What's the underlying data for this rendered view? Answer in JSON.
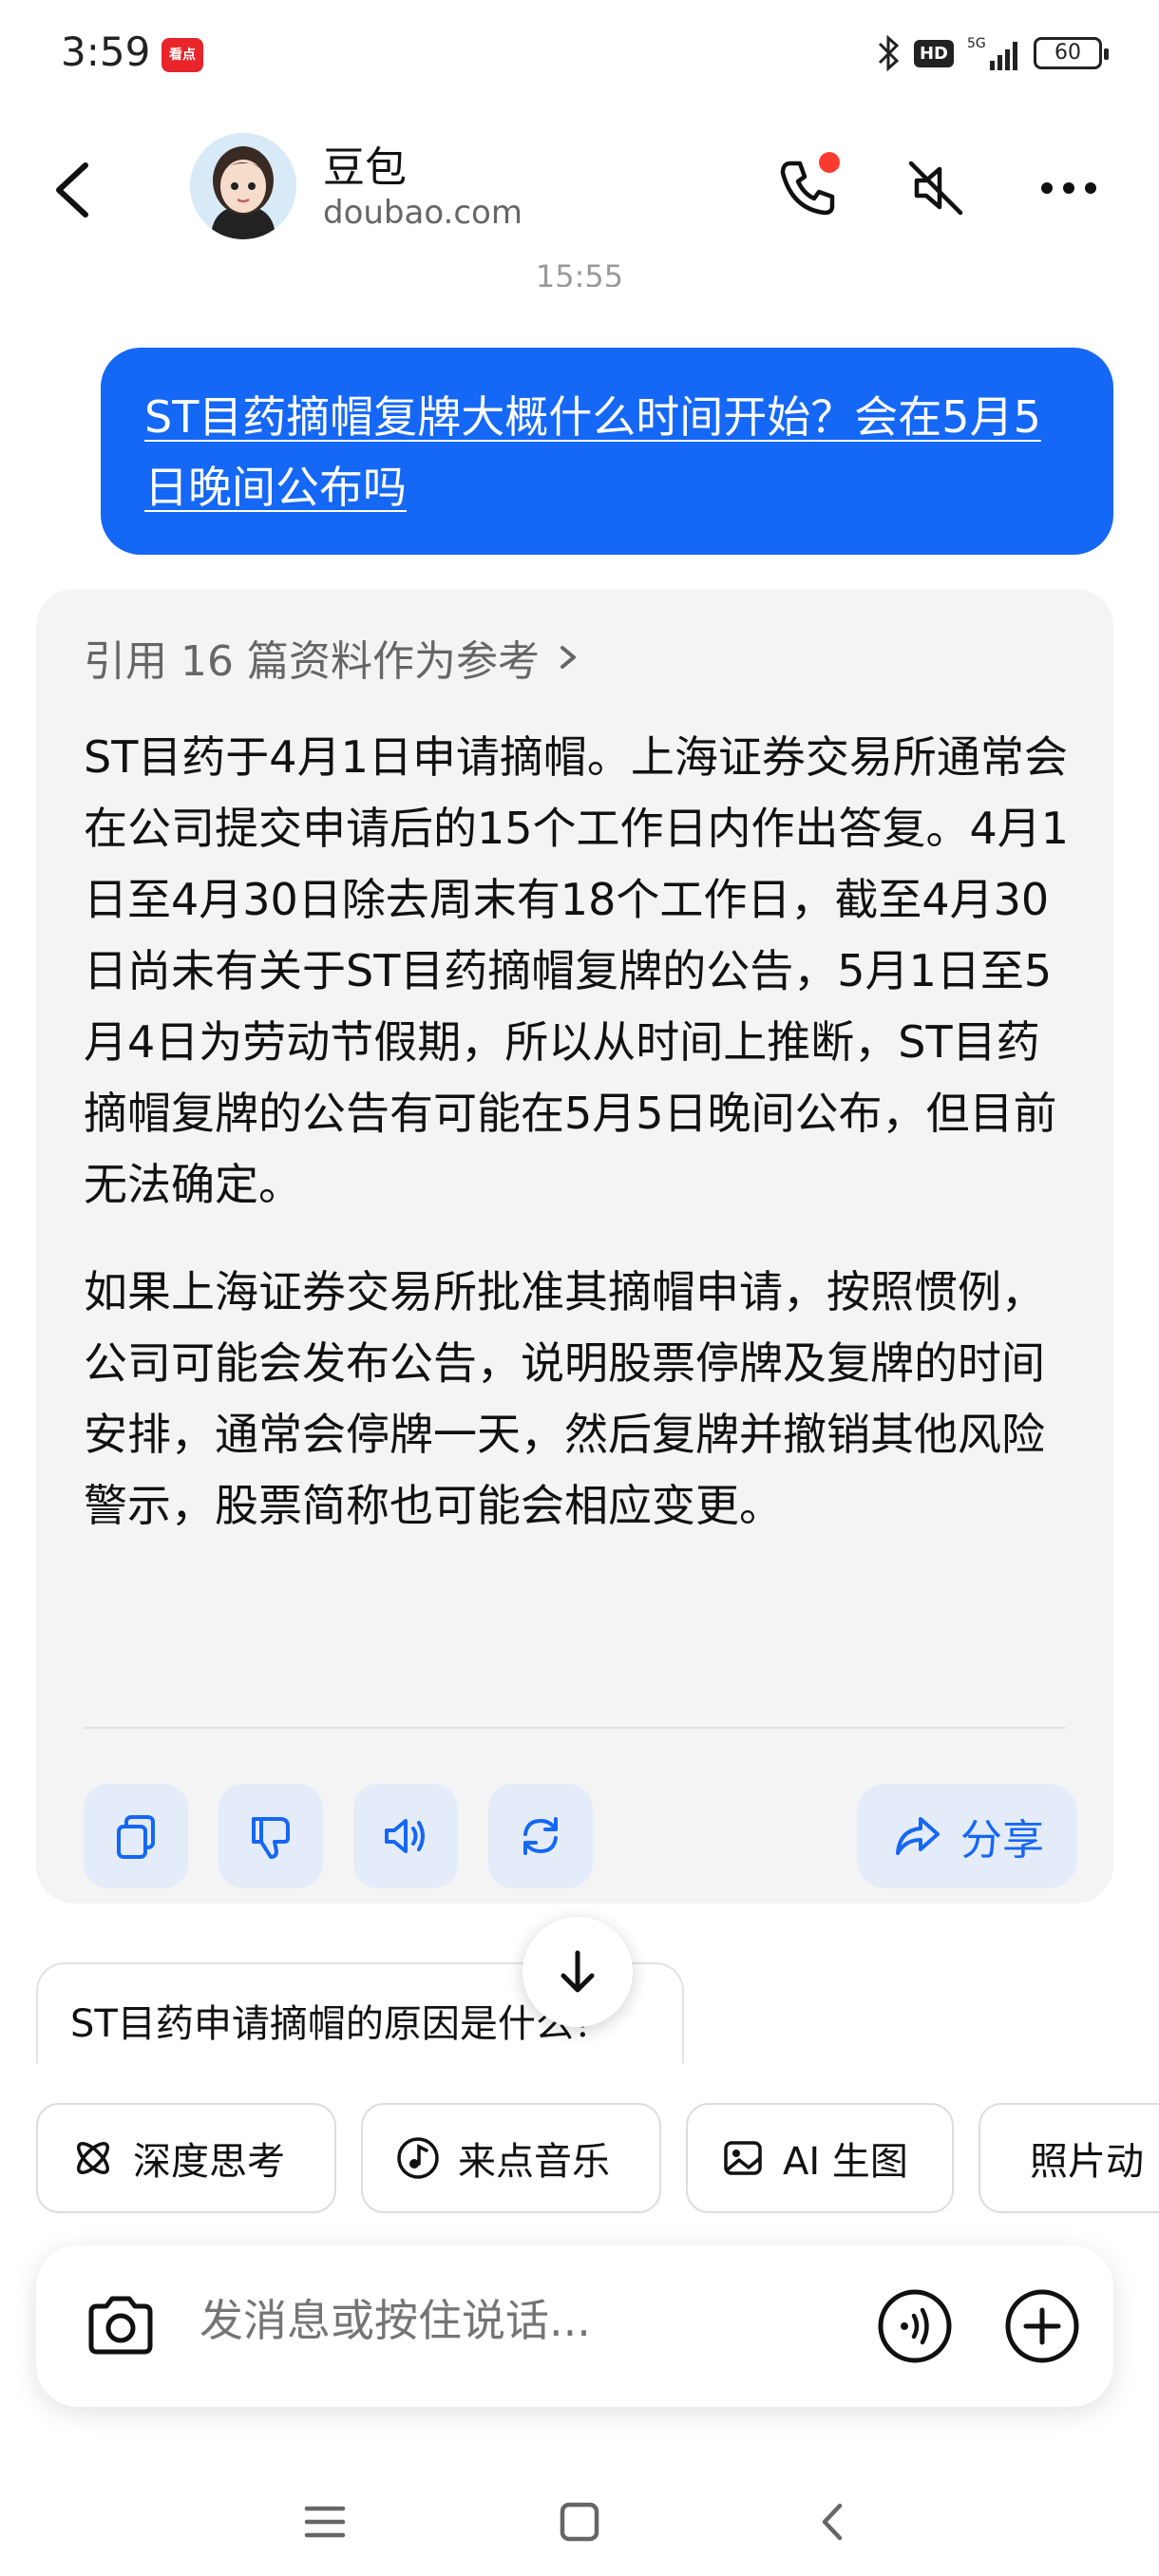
{
  "status_bar": {
    "time": "3:59",
    "app_badge": "看点",
    "hd": "HD",
    "network": "5G",
    "battery": "60"
  },
  "header": {
    "title": "豆包",
    "subtitle": "doubao.com"
  },
  "timestamp": "15:55",
  "user_message": "ST目药摘帽复牌大概什么时间开始？会在5月5日晚间公布吗",
  "answer": {
    "reference_label": "引用 16 篇资料作为参考",
    "paragraph_1": "ST目药于4月1日申请摘帽。上海证券交易所通常会在公司提交申请后的15个工作日内作出答复。4月1日至4月30日除去周末有18个工作日，截至4月30日尚未有关于ST目药摘帽复牌的公告，5月1日至5月4日为劳动节假期，所以从时间上推断，ST目药摘帽复牌的公告有可能在5月5日晚间公布，但目前无法确定。",
    "paragraph_2": "如果上海证券交易所批准其摘帽申请，按照惯例，公司可能会发布公告，说明股票停牌及复牌的时间安排，通常会停牌一天，然后复牌并撤销其他风险警示，股票简称也可能会相应变更。",
    "share_label": "分享"
  },
  "suggestion": "ST目药申请摘帽的原因是什么？",
  "chips": [
    {
      "label": "深度思考",
      "icon": "atom-icon"
    },
    {
      "label": "来点音乐",
      "icon": "music-note-icon"
    },
    {
      "label": "AI 生图",
      "icon": "image-icon"
    },
    {
      "label": "照片动",
      "icon": "play-icon"
    }
  ],
  "input": {
    "placeholder": "发消息或按住说话..."
  },
  "colors": {
    "accent": "#1567f5",
    "card_bg": "#f4f4f5",
    "action_bg": "#e5ecf9"
  }
}
